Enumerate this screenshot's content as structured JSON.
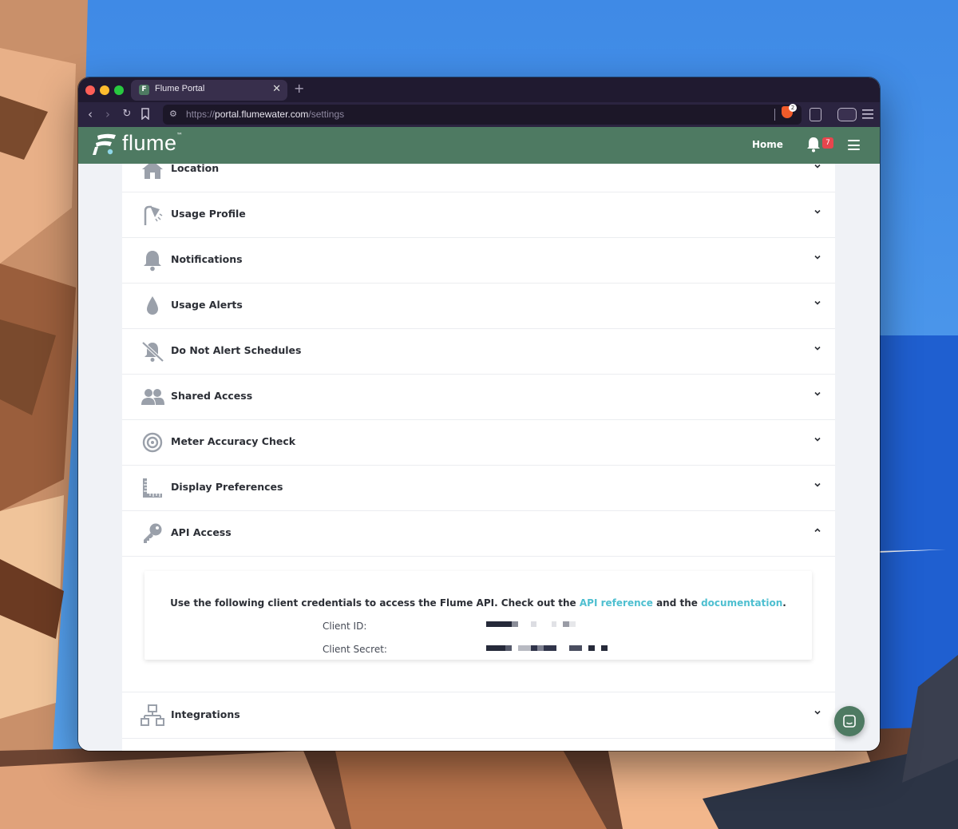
{
  "browser": {
    "tab_title": "Flume Portal",
    "tab_close": "✕",
    "new_tab": "+",
    "url_scheme": "https://",
    "url_host": "portal.flumewater.com",
    "url_path": "/settings",
    "shield_count": "2"
  },
  "app": {
    "logo_text": "flume",
    "logo_tm": "™",
    "nav_home": "Home",
    "notification_count": "7",
    "brand_color": "#4e7a62",
    "link_color": "#4ebfd0",
    "badge_color": "#e7454d"
  },
  "settings": {
    "sections": [
      {
        "label": "Location",
        "icon": "home-icon",
        "expanded": false
      },
      {
        "label": "Usage Profile",
        "icon": "shower-icon",
        "expanded": false
      },
      {
        "label": "Notifications",
        "icon": "bell-icon",
        "expanded": false
      },
      {
        "label": "Usage Alerts",
        "icon": "water-drop-icon",
        "expanded": false
      },
      {
        "label": "Do Not Alert Schedules",
        "icon": "bell-slash-icon",
        "expanded": false
      },
      {
        "label": "Shared Access",
        "icon": "users-icon",
        "expanded": false
      },
      {
        "label": "Meter Accuracy Check",
        "icon": "target-icon",
        "expanded": false
      },
      {
        "label": "Display Preferences",
        "icon": "ruler-icon",
        "expanded": false
      },
      {
        "label": "API Access",
        "icon": "key-icon",
        "expanded": true
      },
      {
        "label": "Integrations",
        "icon": "network-icon",
        "expanded": false
      }
    ],
    "api": {
      "desc_prefix": "Use the following client credentials to access the Flume API. Check out the",
      "link_api_reference": "API reference",
      "desc_middle": "and the",
      "link_documentation": "documentation",
      "desc_suffix": ".",
      "client_id_label": "Client ID:",
      "client_secret_label": "Client Secret:"
    }
  }
}
